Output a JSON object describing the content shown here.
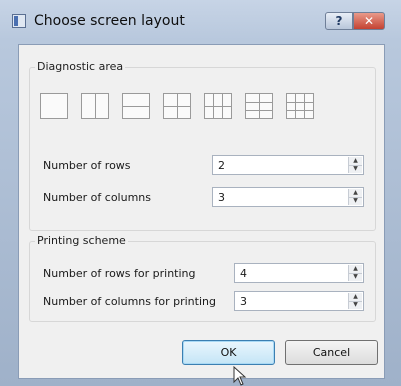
{
  "window": {
    "title": "Choose screen layout",
    "help_glyph": "?",
    "close_glyph": "✕"
  },
  "diagnostic_area": {
    "title": "Diagnostic area",
    "layouts": [
      {
        "icon": "layout-1x1-icon"
      },
      {
        "icon": "layout-1x2-icon"
      },
      {
        "icon": "layout-2x1-icon"
      },
      {
        "icon": "layout-2x2-icon"
      },
      {
        "icon": "layout-2x3-icon"
      },
      {
        "icon": "layout-3x2-icon"
      },
      {
        "icon": "layout-3x3-icon"
      }
    ],
    "rows_label": "Number of rows",
    "rows_value": "2",
    "columns_label": "Number of columns",
    "columns_value": "3"
  },
  "printing_scheme": {
    "title": "Printing scheme",
    "rows_label": "Number of rows for printing",
    "rows_value": "4",
    "columns_label": "Number of columns for printing",
    "columns_value": "3"
  },
  "buttons": {
    "ok": "OK",
    "cancel": "Cancel"
  },
  "spin_glyphs": {
    "up": "▲",
    "down": "▼"
  }
}
